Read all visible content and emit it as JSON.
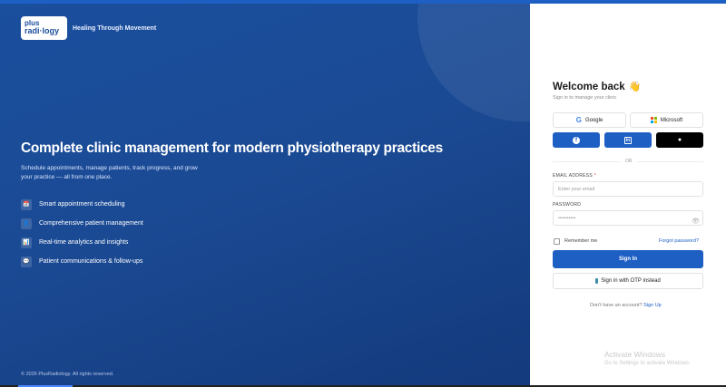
{
  "brand": {
    "logo_line1": "plus",
    "logo_line2": "radi·logy",
    "tagline": "Healing Through Movement"
  },
  "hero": {
    "headline": "Complete clinic management for modern physiotherapy practices",
    "subtext": "Schedule appointments, manage patients, track progress, and grow your practice — all from one place.",
    "features": [
      {
        "icon": "calendar-icon",
        "glyph": "📅",
        "label": "Smart appointment scheduling"
      },
      {
        "icon": "patients-icon",
        "glyph": "👤",
        "label": "Comprehensive patient management"
      },
      {
        "icon": "analytics-icon",
        "glyph": "📊",
        "label": "Real-time analytics and insights"
      },
      {
        "icon": "message-icon",
        "glyph": "💬",
        "label": "Patient communications & follow-ups"
      }
    ],
    "copyright": "© 2026 PlusRadiology. All rights reserved."
  },
  "login": {
    "title": "Welcome back",
    "title_emoji": "👋",
    "subtitle": "Sign in to manage your clinic",
    "social": {
      "google": "Google",
      "microsoft": "Microsoft",
      "facebook_glyph": "f",
      "linkedin_glyph": "in",
      "apple_glyph": ""
    },
    "or": "OR",
    "email": {
      "label": "EMAIL ADDRESS",
      "required": "*",
      "placeholder": "Enter your email"
    },
    "password": {
      "label": "PASSWORD",
      "placeholder": "••••••••••",
      "eye_glyph": "👁"
    },
    "remember": "Remember me",
    "forgot": "Forgot password?",
    "sign_in": "Sign In",
    "otp": "Sign in with OTP instead",
    "signup_prompt": "Don't have an account?",
    "signup_link": "Sign Up"
  },
  "watermark": {
    "title": "Activate Windows",
    "sub": "Go to Settings to activate Windows."
  },
  "colors": {
    "primary": "#1e5fc4",
    "hero_bg": "#1b4a94",
    "apple": "#000000"
  }
}
